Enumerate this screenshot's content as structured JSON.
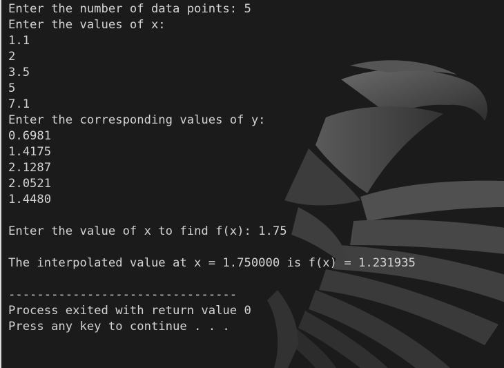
{
  "console": {
    "lines": [
      "Enter the number of data points: 5",
      "Enter the values of x:",
      "1.1",
      "2",
      "3.5",
      "5",
      "7.1",
      "Enter the corresponding values of y:",
      "0.6981",
      "1.4175",
      "2.1287",
      "2.0521",
      "1.4480",
      "",
      "Enter the value of x to find f(x): 1.75",
      "",
      "The interpolated value at x = 1.750000 is f(x) = 1.231935",
      "",
      "--------------------------------",
      "Process exited with return value 0",
      "Press any key to continue . . ."
    ]
  },
  "colors": {
    "background": "#1b1b1b",
    "text": "#d4d4d4",
    "watermark": "#4a4a4a"
  },
  "icons": {
    "watermark": "eagle-watermark-icon"
  }
}
